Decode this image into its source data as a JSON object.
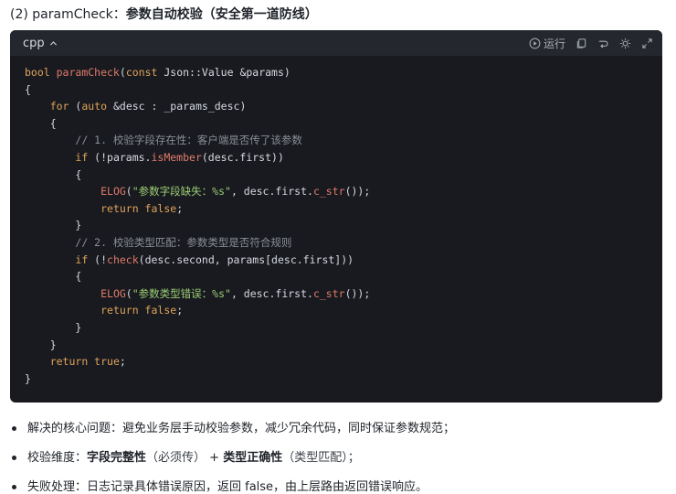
{
  "heading": {
    "prefix": "(2) paramCheck：",
    "title": "参数自动校验（安全第一道防线）"
  },
  "code_block": {
    "language": "cpp",
    "run_label": "运行",
    "icons": [
      "play-icon",
      "copy-icon",
      "wrap-icon",
      "theme-icon",
      "expand-icon"
    ],
    "lines": [
      [
        [
          "kw",
          "bool "
        ],
        [
          "fn",
          "paramCheck"
        ],
        [
          "plain",
          "("
        ],
        [
          "kw",
          "const "
        ],
        [
          "plain",
          "Json::Value &params)"
        ]
      ],
      [
        [
          "plain",
          "{"
        ]
      ],
      [
        [
          "plain",
          "    "
        ],
        [
          "kw",
          "for "
        ],
        [
          "plain",
          "("
        ],
        [
          "kw",
          "auto "
        ],
        [
          "plain",
          "&desc : _params_desc)"
        ]
      ],
      [
        [
          "plain",
          "    {"
        ]
      ],
      [
        [
          "plain",
          "        "
        ],
        [
          "cmt",
          "// 1. 校验字段存在性：客户端是否传了该参数"
        ]
      ],
      [
        [
          "plain",
          "        "
        ],
        [
          "kw",
          "if "
        ],
        [
          "plain",
          "(!params."
        ],
        [
          "fn",
          "isMember"
        ],
        [
          "plain",
          "(desc.first))"
        ]
      ],
      [
        [
          "plain",
          "        {"
        ]
      ],
      [
        [
          "plain",
          "            "
        ],
        [
          "fn",
          "ELOG"
        ],
        [
          "plain",
          "("
        ],
        [
          "str",
          "\"参数字段缺失：%s\""
        ],
        [
          "plain",
          ", desc.first."
        ],
        [
          "fn",
          "c_str"
        ],
        [
          "plain",
          "());"
        ]
      ],
      [
        [
          "plain",
          "            "
        ],
        [
          "kw",
          "return false"
        ],
        [
          "plain",
          ";"
        ]
      ],
      [
        [
          "plain",
          "        }"
        ]
      ],
      [
        [
          "plain",
          "        "
        ],
        [
          "cmt",
          "// 2. 校验类型匹配：参数类型是否符合规则"
        ]
      ],
      [
        [
          "plain",
          "        "
        ],
        [
          "kw",
          "if "
        ],
        [
          "plain",
          "(!"
        ],
        [
          "fn",
          "check"
        ],
        [
          "plain",
          "(desc.second, params[desc.first]))"
        ]
      ],
      [
        [
          "plain",
          "        {"
        ]
      ],
      [
        [
          "plain",
          "            "
        ],
        [
          "fn",
          "ELOG"
        ],
        [
          "plain",
          "("
        ],
        [
          "str",
          "\"参数类型错误：%s\""
        ],
        [
          "plain",
          ", desc.first."
        ],
        [
          "fn",
          "c_str"
        ],
        [
          "plain",
          "());"
        ]
      ],
      [
        [
          "plain",
          "            "
        ],
        [
          "kw",
          "return false"
        ],
        [
          "plain",
          ";"
        ]
      ],
      [
        [
          "plain",
          "        }"
        ]
      ],
      [
        [
          "plain",
          "    }"
        ]
      ],
      [
        [
          "plain",
          "    "
        ],
        [
          "kw",
          "return true"
        ],
        [
          "plain",
          ";"
        ]
      ],
      [
        [
          "plain",
          "}"
        ]
      ]
    ]
  },
  "bullets": [
    {
      "parts": [
        [
          "n",
          "解决的核心问题：避免业务层手动校验参数，减少冗余代码，同时保证参数规范；"
        ]
      ]
    },
    {
      "parts": [
        [
          "n",
          "校验维度："
        ],
        [
          "b",
          "字段完整性"
        ],
        [
          "m",
          "（必须传）"
        ],
        [
          "n",
          " + "
        ],
        [
          "b",
          "类型正确性"
        ],
        [
          "m",
          "（类型匹配）；"
        ]
      ]
    },
    {
      "parts": [
        [
          "n",
          "失败处理：日志记录具体错误原因，返回 false，由上层路由返回错误响应。"
        ]
      ]
    }
  ],
  "colors": {
    "code_bg": "#181a1f",
    "header_bg": "#24272d",
    "keyword": "#e0a35a",
    "function": "#e07a6a",
    "string": "#9ccc74",
    "comment": "#8a8f98"
  }
}
